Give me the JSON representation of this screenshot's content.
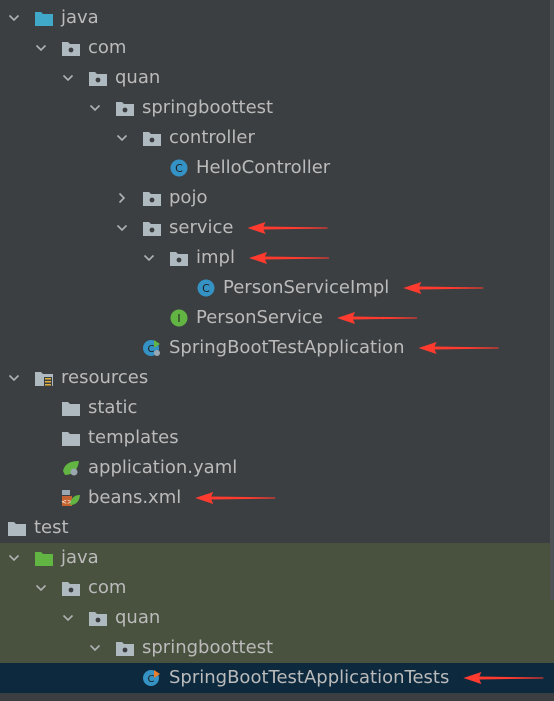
{
  "tree": [
    {
      "id": "java-main",
      "label": "java",
      "depth": 0,
      "chevron": "down",
      "icon": "folder-source-icon"
    },
    {
      "id": "com-main",
      "label": "com",
      "depth": 1,
      "chevron": "down",
      "icon": "package-icon"
    },
    {
      "id": "quan-main",
      "label": "quan",
      "depth": 2,
      "chevron": "down",
      "icon": "package-icon"
    },
    {
      "id": "springboottest-main",
      "label": "springboottest",
      "depth": 3,
      "chevron": "down",
      "icon": "package-icon"
    },
    {
      "id": "controller",
      "label": "controller",
      "depth": 4,
      "chevron": "down",
      "icon": "package-icon"
    },
    {
      "id": "hello-controller",
      "label": "HelloController",
      "depth": 5,
      "chevron": "none",
      "icon": "class-icon"
    },
    {
      "id": "pojo",
      "label": "pojo",
      "depth": 4,
      "chevron": "right",
      "icon": "package-icon"
    },
    {
      "id": "service",
      "label": "service",
      "depth": 4,
      "chevron": "down",
      "icon": "package-icon"
    },
    {
      "id": "impl",
      "label": "impl",
      "depth": 5,
      "chevron": "down",
      "icon": "package-icon"
    },
    {
      "id": "person-service-impl",
      "label": "PersonServiceImpl",
      "depth": 6,
      "chevron": "none",
      "icon": "class-icon"
    },
    {
      "id": "person-service",
      "label": "PersonService",
      "depth": 5,
      "chevron": "none",
      "icon": "interface-icon"
    },
    {
      "id": "spring-boot-test-application",
      "label": "SpringBootTestApplication",
      "depth": 4,
      "chevron": "none",
      "icon": "spring-boot-class-icon"
    },
    {
      "id": "resources",
      "label": "resources",
      "depth": 0,
      "chevron": "down",
      "icon": "resources-folder-icon"
    },
    {
      "id": "static",
      "label": "static",
      "depth": 1,
      "chevron": "none",
      "icon": "folder-icon"
    },
    {
      "id": "templates",
      "label": "templates",
      "depth": 1,
      "chevron": "none",
      "icon": "folder-icon"
    },
    {
      "id": "application-yaml",
      "label": "application.yaml",
      "depth": 1,
      "chevron": "none",
      "icon": "yaml-spring-icon"
    },
    {
      "id": "beans-xml",
      "label": "beans.xml",
      "depth": 1,
      "chevron": "none",
      "icon": "xml-spring-icon"
    },
    {
      "id": "test",
      "label": "test",
      "depth": -1,
      "chevron": "none",
      "icon": "folder-icon"
    },
    {
      "id": "java-test",
      "label": "java",
      "depth": 0,
      "chevron": "down",
      "icon": "folder-test-source-icon"
    },
    {
      "id": "com-test",
      "label": "com",
      "depth": 1,
      "chevron": "down",
      "icon": "package-icon"
    },
    {
      "id": "quan-test",
      "label": "quan",
      "depth": 2,
      "chevron": "down",
      "icon": "package-icon"
    },
    {
      "id": "springboottest-test",
      "label": "springboottest",
      "depth": 3,
      "chevron": "down",
      "icon": "package-icon"
    },
    {
      "id": "spring-boot-test-application-tests",
      "label": "SpringBootTestApplicationTests",
      "depth": 4,
      "chevron": "none",
      "icon": "spring-boot-test-class-icon"
    }
  ],
  "selected": "spring-boot-test-application-tests",
  "test_background_rows": [
    "java-test",
    "com-test",
    "quan-test",
    "springboottest-test"
  ],
  "annotation_arrows": [
    "service",
    "impl",
    "person-service-impl",
    "person-service",
    "spring-boot-test-application",
    "beans-xml",
    "spring-boot-test-application-tests"
  ],
  "colors": {
    "background": "#3c3f41",
    "text": "#bbbbbb",
    "test_background": "#49513f",
    "selection": "#0d293e",
    "arrow": "#ff3b30",
    "class_icon": "#3592c4",
    "interface_icon": "#62b543",
    "folder_icon": "#aeb9c0",
    "source_folder": "#40a9c9",
    "test_folder": "#62b543"
  }
}
